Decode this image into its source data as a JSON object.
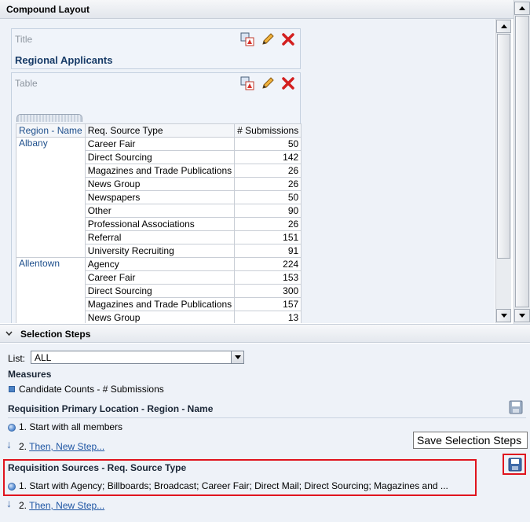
{
  "compound": {
    "title": "Compound Layout",
    "title_view": {
      "label": "Title",
      "value": "Regional Applicants"
    },
    "table_view": {
      "label": "Table",
      "headers": [
        "Region - Name",
        "Req. Source Type",
        "# Submissions"
      ],
      "groups": [
        {
          "region": "Albany",
          "rows": [
            {
              "source": "Career Fair",
              "count": "50"
            },
            {
              "source": "Direct Sourcing",
              "count": "142"
            },
            {
              "source": "Magazines and Trade Publications",
              "count": "26"
            },
            {
              "source": "News Group",
              "count": "26"
            },
            {
              "source": "Newspapers",
              "count": "50"
            },
            {
              "source": "Other",
              "count": "90"
            },
            {
              "source": "Professional Associations",
              "count": "26"
            },
            {
              "source": "Referral",
              "count": "151"
            },
            {
              "source": "University Recruiting",
              "count": "91"
            }
          ]
        },
        {
          "region": "Allentown",
          "rows": [
            {
              "source": "Agency",
              "count": "224"
            },
            {
              "source": "Career Fair",
              "count": "153"
            },
            {
              "source": "Direct Sourcing",
              "count": "300"
            },
            {
              "source": "Magazines and Trade Publications",
              "count": "157"
            },
            {
              "source": "News Group",
              "count": "13"
            }
          ]
        }
      ]
    }
  },
  "selection_steps": {
    "title": "Selection Steps",
    "list_label": "List:",
    "list_value": "ALL",
    "measures_title": "Measures",
    "measure_item": "Candidate Counts - # Submissions",
    "section1": {
      "title": "Requisition Primary Location - Region - Name",
      "step1": "1. Start with all members",
      "step2_prefix": "2.",
      "step2_link": "Then, New Step..."
    },
    "tooltip": "Save Selection Steps",
    "section2": {
      "title": "Requisition Sources - Req. Source Type",
      "step1": "1. Start with Agency; Billboards; Broadcast; Career Fair; Direct Mail; Direct Sourcing; Magazines and ...",
      "step2_prefix": "2.",
      "step2_link": "Then, New Step..."
    }
  },
  "colors": {
    "highlight": "#e0141e",
    "link": "#1e55a3",
    "panel_bg": "#eef2f8"
  },
  "icons": [
    "format-view-icon",
    "edit-pencil-icon",
    "delete-x-icon",
    "save-disk-icon",
    "chevron-down-icon",
    "arrow-down-icon"
  ]
}
